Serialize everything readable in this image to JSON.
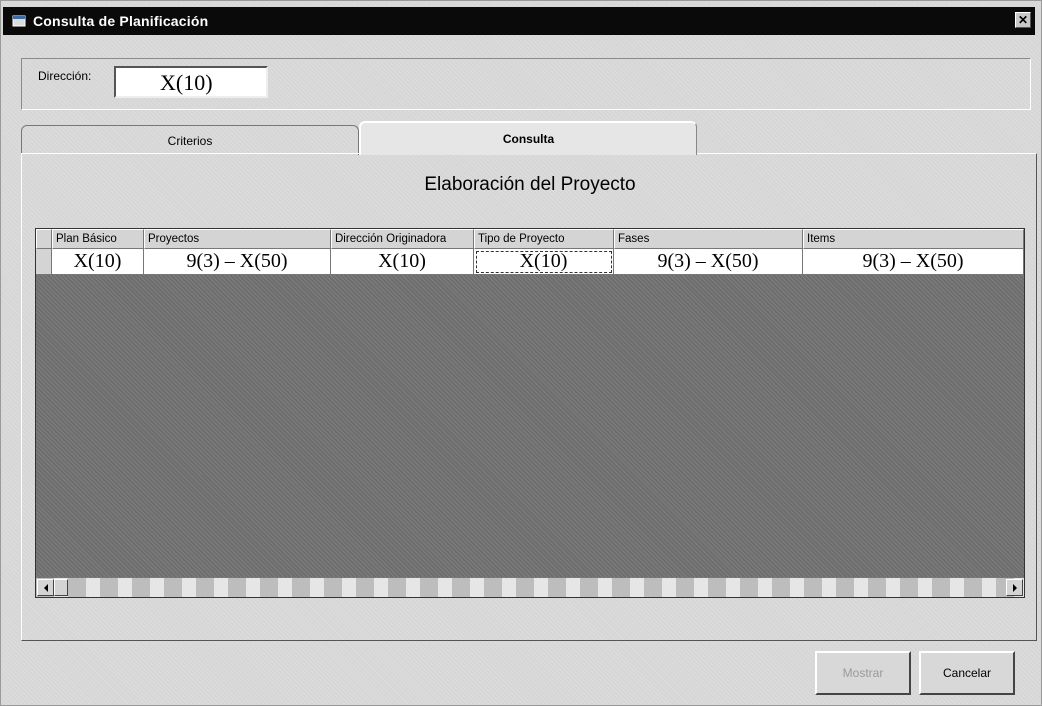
{
  "window": {
    "title": "Consulta de Planificación",
    "icon": "app-icon",
    "close_label": "✕"
  },
  "direccion": {
    "label": "Dirección:",
    "value": "X(10)"
  },
  "tabs": [
    {
      "label": "Criterios"
    },
    {
      "label": "Consulta"
    }
  ],
  "panel": {
    "caption": "Elaboración del Proyecto"
  },
  "grid": {
    "columns": [
      "Plan Básico",
      "Proyectos",
      "Dirección Originadora",
      "Tipo de Proyecto",
      "Fases",
      "Items"
    ],
    "row": [
      "X(10)",
      "9(3) – X(50)",
      "X(10)",
      "X(10)",
      "9(3) – X(50)",
      "9(3) – X(50)"
    ]
  },
  "buttons": {
    "mostrar": "Mostrar",
    "cancelar": "Cancelar"
  }
}
